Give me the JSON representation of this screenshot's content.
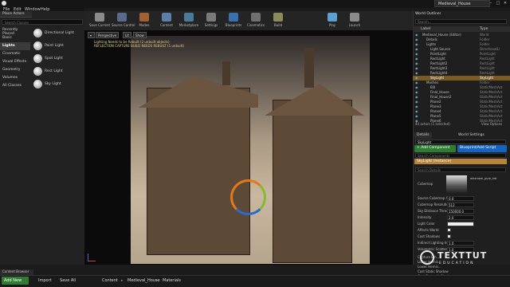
{
  "app": {
    "tab_title": "Medieval_House"
  },
  "menu": [
    "File",
    "Edit",
    "Window",
    "Help"
  ],
  "toolbar": [
    {
      "label": "Save Current",
      "icon": "save-icon",
      "color": "#8a8a8a"
    },
    {
      "label": "Source Control",
      "icon": "source-control-icon",
      "color": "#5a6b8a"
    },
    {
      "label": "Modes",
      "icon": "modes-icon",
      "color": "#a06030"
    },
    {
      "label": "Content",
      "icon": "content-icon",
      "color": "#5a7fa8"
    },
    {
      "label": "Marketplace",
      "icon": "marketplace-icon",
      "color": "#4a7a9a"
    },
    {
      "label": "Settings",
      "icon": "settings-gear-icon",
      "color": "#7a7a7a"
    },
    {
      "label": "Blueprints",
      "icon": "blueprints-icon",
      "color": "#3a6fb0"
    },
    {
      "label": "Cinematics",
      "icon": "cinematics-icon",
      "color": "#707070"
    },
    {
      "label": "Build",
      "icon": "build-icon",
      "color": "#8a8a5a"
    },
    {
      "label": "Play",
      "icon": "play-icon",
      "color": "#5aa0d0"
    },
    {
      "label": "Launch",
      "icon": "launch-icon",
      "color": "#8a8a8a"
    }
  ],
  "modes": {
    "tab": "Place Actors",
    "search_placeholder": "Search Classes",
    "categories": [
      "Recently Placed",
      "Basic",
      "Lights",
      "Cinematic",
      "Visual Effects",
      "Geometry",
      "Volumes",
      "All Classes"
    ],
    "selected_category": "Lights",
    "actors": [
      "Directional Light",
      "Point Light",
      "Spot Light",
      "Rect Light",
      "Sky Light"
    ]
  },
  "viewport": {
    "buttons": [
      "Perspective",
      "Lit",
      "Show"
    ],
    "messages": [
      "Lighting Needs to be Rebuilt (2 unbuilt objects)",
      "REFLECTION CAPTURE BUILD NEEDS REBUILT (1 unbuilt)"
    ]
  },
  "outliner": {
    "tab": "World Outliner",
    "search_placeholder": "Search...",
    "columns": [
      "Label",
      "Type"
    ],
    "rows": [
      {
        "name": "Medieval_House (Editor)",
        "type": "World",
        "indent": 0
      },
      {
        "name": "Details",
        "type": "Folder",
        "indent": 1
      },
      {
        "name": "Lights",
        "type": "Folder",
        "indent": 1
      },
      {
        "name": "Light Source",
        "type": "DirectionalLi",
        "indent": 2
      },
      {
        "name": "PointLight",
        "type": "PointLight",
        "indent": 2
      },
      {
        "name": "RectLight",
        "type": "RectLight",
        "indent": 2
      },
      {
        "name": "RectLight2",
        "type": "RectLight",
        "indent": 2
      },
      {
        "name": "RectLight3",
        "type": "RectLight",
        "indent": 2
      },
      {
        "name": "RectLight4",
        "type": "RectLight",
        "indent": 2
      },
      {
        "name": "SkyLight",
        "type": "SkyLight",
        "indent": 2,
        "selected": true
      },
      {
        "name": "Meshes",
        "type": "Folder",
        "indent": 1
      },
      {
        "name": "Bill",
        "type": "StaticMeshAct",
        "indent": 2
      },
      {
        "name": "Final_House",
        "type": "StaticMeshAct",
        "indent": 2
      },
      {
        "name": "Final_House2",
        "type": "StaticMeshAct",
        "indent": 2
      },
      {
        "name": "Plane2",
        "type": "StaticMeshAct",
        "indent": 2
      },
      {
        "name": "Plane3",
        "type": "StaticMeshAct",
        "indent": 2
      },
      {
        "name": "Plane4",
        "type": "StaticMeshAct",
        "indent": 2
      },
      {
        "name": "Plane5",
        "type": "StaticMeshAct",
        "indent": 2
      },
      {
        "name": "Plane6",
        "type": "StaticMeshAct",
        "indent": 2
      }
    ],
    "footer": "44 actors (1 selected)",
    "view_options": "View Options"
  },
  "details": {
    "tabs": [
      "Details",
      "World Settings"
    ],
    "name_value": "SkyLight",
    "add_component": "+ Add Component",
    "blueprint_button": "Blueprint/Add Script",
    "component_search": "Search Components",
    "component_row": "SkyLight (Instance)",
    "search_placeholder": "Search Details",
    "cubemap_label": "Cubemap",
    "cubemap_asset": "alexroom_pure_hdr",
    "properties": [
      {
        "label": "Source Cubemap Ang",
        "value": "0.0"
      },
      {
        "label": "Cubemap Resolution",
        "value": "512"
      },
      {
        "label": "Sky Distance Thresh",
        "value": "150000.0"
      },
      {
        "label": "Intensity",
        "value": "2.0"
      },
      {
        "label": "Light Color",
        "value": ""
      },
      {
        "label": "Affects World",
        "checkbox": true
      },
      {
        "label": "Cast Shadows",
        "checkbox": true
      },
      {
        "label": "Indirect Lighting Int",
        "value": "1.0"
      },
      {
        "label": "Volumetric Scattering",
        "value": "1.0"
      }
    ],
    "more_labels": [
      "Capture Em...",
      "Lower Hemis...",
      "Lower Hemis...",
      "Cast Static Shadow",
      "Cast Dynamic Shado"
    ]
  },
  "content_browser": {
    "tab": "Content Browser",
    "add_new": "Add New",
    "import": "Import",
    "save_all": "Save All",
    "path": [
      "Content",
      "Medieval_House",
      "Materials"
    ]
  },
  "watermark": {
    "name": "TEXTTUT",
    "sub": "EDUCATION"
  }
}
